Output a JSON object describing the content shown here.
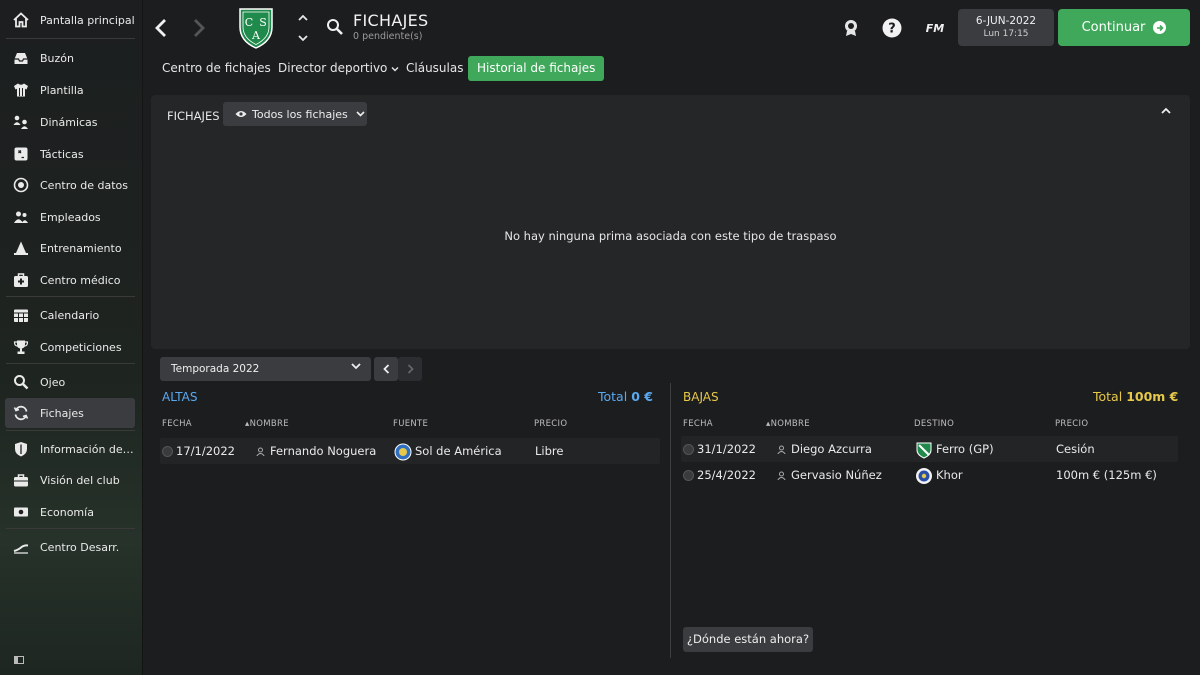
{
  "sidebar": {
    "items": [
      {
        "label": "Pantalla principal",
        "icon": "home-icon"
      },
      {
        "label": "Buzón",
        "icon": "inbox-icon"
      },
      {
        "label": "Plantilla",
        "icon": "shirt-icon"
      },
      {
        "label": "Dinámicas",
        "icon": "dynamics-icon"
      },
      {
        "label": "Tácticas",
        "icon": "tactics-icon"
      },
      {
        "label": "Centro de datos",
        "icon": "data-hub-icon"
      },
      {
        "label": "Empleados",
        "icon": "staff-icon"
      },
      {
        "label": "Entrenamiento",
        "icon": "training-cone-icon"
      },
      {
        "label": "Centro médico",
        "icon": "medical-kit-icon"
      },
      {
        "label": "Calendario",
        "icon": "calendar-icon"
      },
      {
        "label": "Competiciones",
        "icon": "trophy-icon"
      },
      {
        "label": "Ojeo",
        "icon": "scouting-search-icon"
      },
      {
        "label": "Fichajes",
        "icon": "transfers-icon"
      },
      {
        "label": "Información del club",
        "icon": "club-shield-icon"
      },
      {
        "label": "Visión del club",
        "icon": "briefcase-icon"
      },
      {
        "label": "Economía",
        "icon": "finances-icon"
      },
      {
        "label": "Centro Desarr.",
        "icon": "development-icon"
      }
    ],
    "active": "Fichajes"
  },
  "header": {
    "crest_letters": [
      "C",
      "S",
      "A"
    ],
    "title": "FICHAJES",
    "subtitle": "0 pendiente(s)",
    "fm_label": "FM",
    "date": "6-JUN-2022",
    "day_time": "Lun 17:15",
    "continue_label": "Continuar"
  },
  "tabs": [
    {
      "label": "Centro de fichajes"
    },
    {
      "label": "Director deportivo"
    },
    {
      "label": "Cláusulas"
    },
    {
      "label": "Historial de fichajes"
    }
  ],
  "bonus_panel": {
    "label": "FICHAJES",
    "filter": "Todos los fichajes",
    "empty_message": "No hay ninguna prima asociada con este tipo de traspaso"
  },
  "season_selector": "Temporada 2022",
  "altas": {
    "title": "ALTAS",
    "total_label": "Total",
    "total_value": "0 €",
    "columns": [
      "FECHA",
      "NOMBRE",
      "FUENTE",
      "PRECIO"
    ],
    "rows": [
      {
        "date": "17/1/2022",
        "name": "Fernando Noguera",
        "club": "Sol de América",
        "price": "Libre"
      }
    ]
  },
  "bajas": {
    "title": "BAJAS",
    "total_label": "Total",
    "total_value": "100m €",
    "columns": [
      "FECHA",
      "NOMBRE",
      "DESTINO",
      "PRECIO"
    ],
    "rows": [
      {
        "date": "31/1/2022",
        "name": "Diego Azcurra",
        "club": "Ferro (GP)",
        "price": "Cesión"
      },
      {
        "date": "25/4/2022",
        "name": "Gervasio Núñez",
        "club": "Khor",
        "price": "100m € (125m €)"
      }
    ]
  },
  "where_now_button": "¿Dónde están ahora?",
  "colors": {
    "accent_green": "#3fa85b",
    "altas_blue": "#5aa9f0",
    "bajas_gold": "#e7c84a",
    "club_green": "#1f8a4c"
  }
}
